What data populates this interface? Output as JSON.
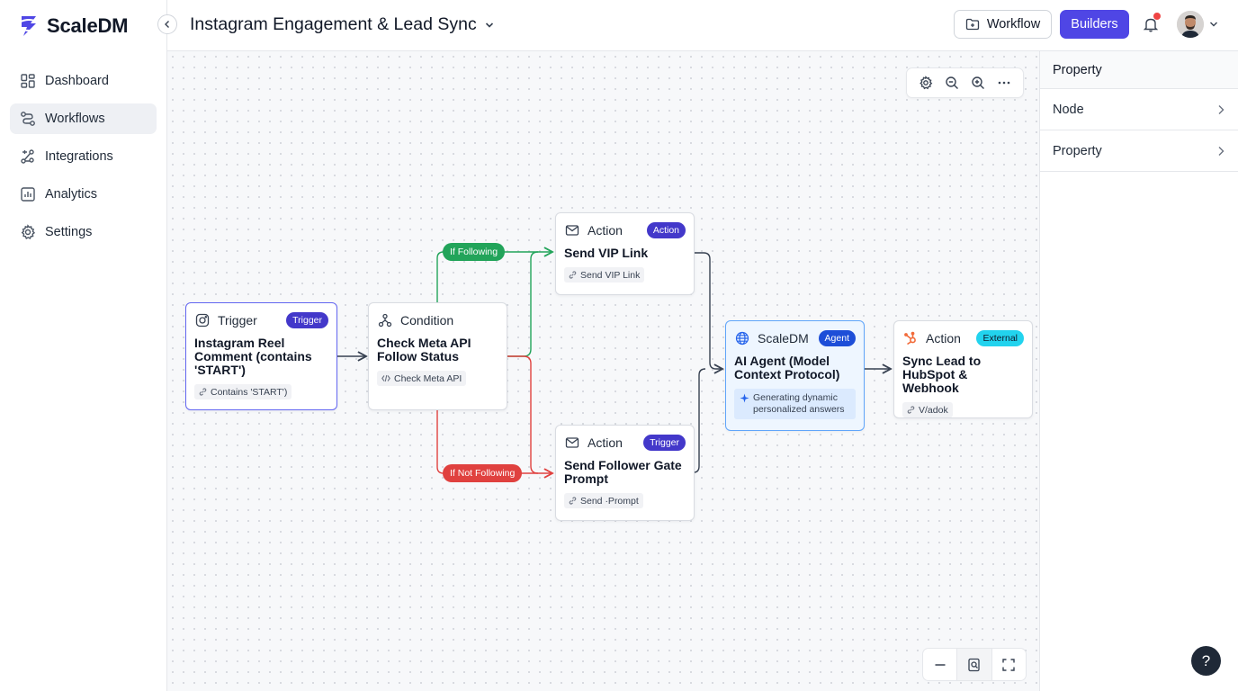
{
  "brand": {
    "name": "ScaleDM"
  },
  "nav": [
    {
      "label": "Dashboard",
      "icon": "dashboard-icon"
    },
    {
      "label": "Workflows",
      "icon": "workflow-icon",
      "active": true
    },
    {
      "label": "Integrations",
      "icon": "integrations-icon"
    },
    {
      "label": "Analytics",
      "icon": "analytics-icon"
    },
    {
      "label": "Settings",
      "icon": "settings-icon"
    }
  ],
  "header": {
    "title": "Instagram Engagement & Lead Sync",
    "workflow_label": "Workflow",
    "builders_label": "Builders"
  },
  "nodes": {
    "trigger": {
      "type": "Trigger",
      "badge": "Trigger",
      "title": "Instagram Reel Comment (contains 'START')",
      "chip": "Contains 'START')"
    },
    "condition": {
      "type": "Condition",
      "title": "Check Meta API Follow Status",
      "chip": "Check Meta API"
    },
    "vip": {
      "type": "Action",
      "badge": "Action",
      "title": "Send VIP Link",
      "chip": "Send VIP Link"
    },
    "gate": {
      "type": "Action",
      "badge": "Trigger",
      "title": "Send Follower Gate Prompt",
      "chip": "Send ·Prompt"
    },
    "agent": {
      "type": "ScaleDM",
      "badge": "Agent",
      "title": "AI Agent (Model Context Protocol)",
      "chip": "Generating dynamic personalized answers"
    },
    "hubspot": {
      "type": "Action",
      "badge": "External",
      "title": "Sync Lead to HubSpot & Webhook",
      "chip": "V/adok"
    }
  },
  "edges": {
    "if_following": "If Following",
    "if_not_following": "If Not Following"
  },
  "panel": {
    "title": "Property",
    "rows": [
      "Node",
      "Property"
    ]
  },
  "colors": {
    "accent": "#4f46e5",
    "edge_green": "#22a45a",
    "edge_red": "#e0413f",
    "edge_default": "#374151"
  },
  "help_label": "?"
}
